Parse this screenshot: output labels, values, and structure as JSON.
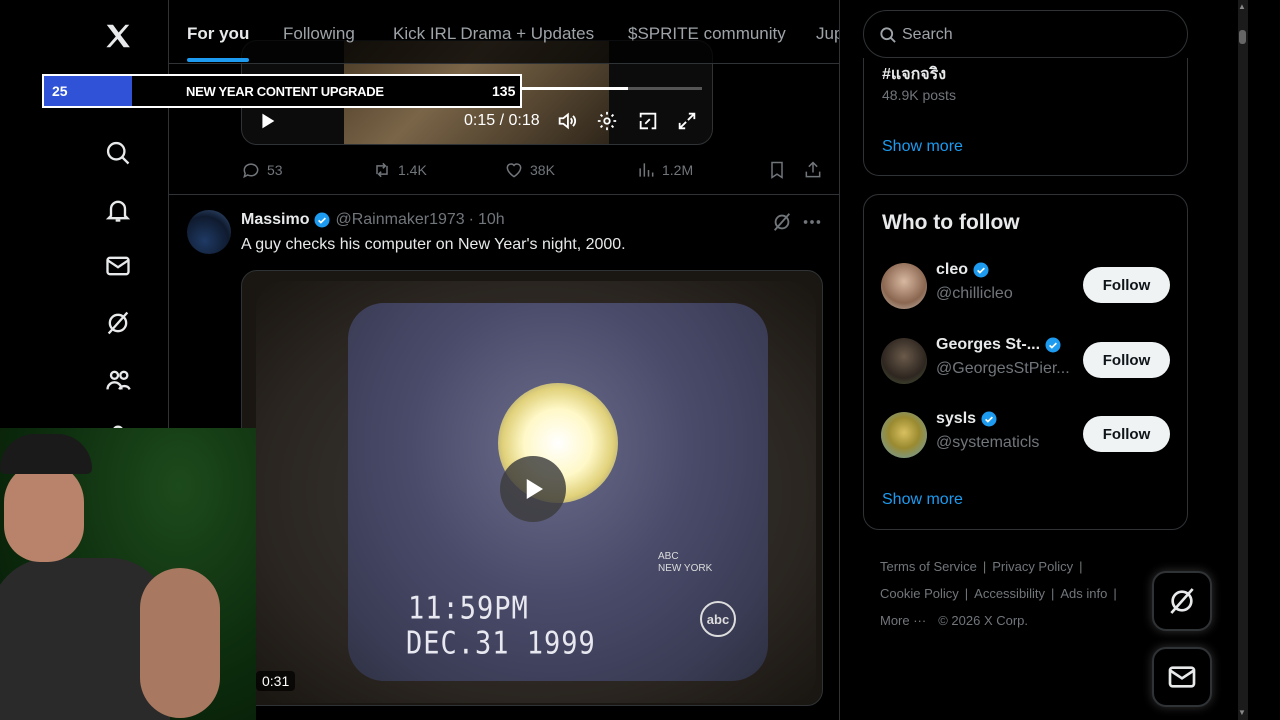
{
  "tabs": [
    {
      "label": "For you",
      "active": true
    },
    {
      "label": "Following"
    },
    {
      "label": "Kick IRL Drama + Updates"
    },
    {
      "label": "$SPRITE community"
    },
    {
      "label": "Jup"
    }
  ],
  "left_nav": {
    "icons": [
      "x-logo-icon",
      "home-icon",
      "search-icon",
      "bell-icon",
      "mail-icon",
      "grok-icon",
      "communities-icon",
      "profile-icon"
    ]
  },
  "stream_goal": {
    "current": "25",
    "label": "NEW YEAR CONTENT UPGRADE",
    "target": "135",
    "progress_fraction": 0.185,
    "fill_color": "#2f52d6"
  },
  "post1": {
    "video": {
      "time": "0:15 / 0:18",
      "progress_fraction": 0.83
    },
    "actions": {
      "replies": "53",
      "reposts": "1.4K",
      "likes": "38K",
      "views": "1.2M"
    }
  },
  "post2": {
    "name": "Massimo",
    "handle": "@Rainmaker1973",
    "dot": "·",
    "time": "10h",
    "text": "A guy checks his computer on New Year's night, 2000.",
    "video": {
      "duration": "0:31",
      "vhs_time": "11:59PM",
      "vhs_date": "DEC.31 1999",
      "station_line1": "NEW YORK",
      "station_line2": "ABC",
      "logo": "abc"
    }
  },
  "search": {
    "placeholder": "Search"
  },
  "trends": {
    "name": "#แจกจริง",
    "posts": "48.9K posts",
    "show_more": "Show more"
  },
  "who_to_follow": {
    "title": "Who to follow",
    "users": [
      {
        "name": "cleo",
        "handle": "@chillicleo",
        "follow": "Follow"
      },
      {
        "name": "Georges St-...",
        "handle": "@GeorgesStPier...",
        "follow": "Follow"
      },
      {
        "name": "sysls",
        "handle": "@systematicls",
        "follow": "Follow"
      }
    ],
    "show_more": "Show more"
  },
  "footer": {
    "terms": "Terms of Service",
    "privacy": "Privacy Policy",
    "cookie": "Cookie Policy",
    "accessibility": "Accessibility",
    "ads": "Ads info",
    "more": "More ···",
    "copyright": "© 2026 X Corp.",
    "sep": "|"
  },
  "colors": {
    "accent": "#1d9bf0",
    "verified": "#1d9bf0",
    "border": "#2f3336"
  }
}
